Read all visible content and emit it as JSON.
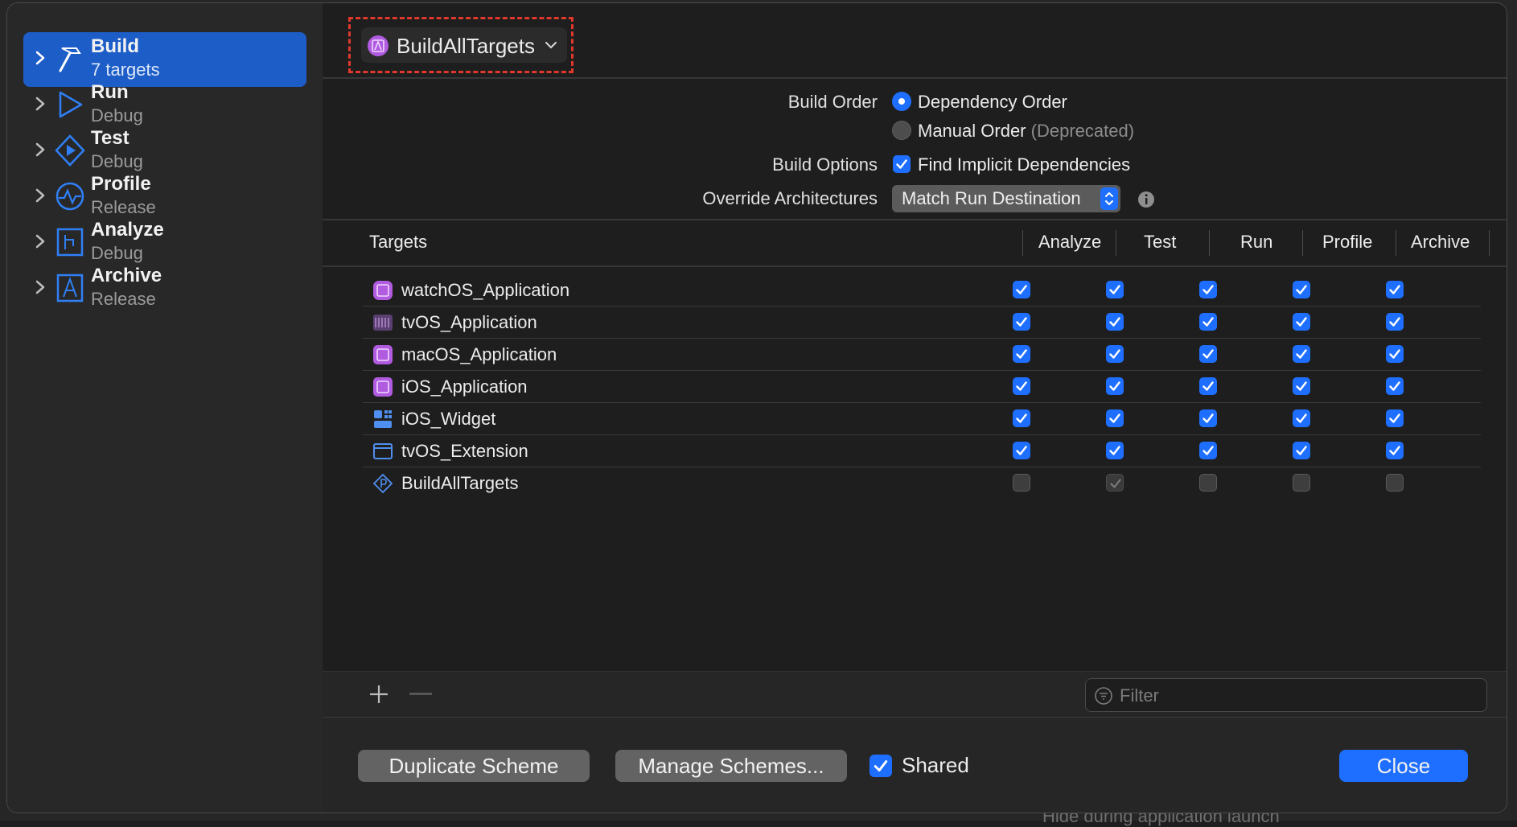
{
  "scheme": {
    "name": "BuildAllTargets"
  },
  "sidebar": {
    "items": [
      {
        "title": "Build",
        "subtitle": "7 targets",
        "selected": true,
        "icon": "hammer-icon"
      },
      {
        "title": "Run",
        "subtitle": "Debug",
        "selected": false,
        "icon": "play-icon"
      },
      {
        "title": "Test",
        "subtitle": "Debug",
        "selected": false,
        "icon": "test-diamond-icon"
      },
      {
        "title": "Profile",
        "subtitle": "Release",
        "selected": false,
        "icon": "gauge-icon"
      },
      {
        "title": "Analyze",
        "subtitle": "Debug",
        "selected": false,
        "icon": "analyze-icon"
      },
      {
        "title": "Archive",
        "subtitle": "Release",
        "selected": false,
        "icon": "archive-icon"
      }
    ]
  },
  "options": {
    "build_order_label": "Build Order",
    "dependency_order": "Dependency Order",
    "manual_order": "Manual Order",
    "manual_order_note": "(Deprecated)",
    "build_options_label": "Build Options",
    "find_implicit": "Find Implicit Dependencies",
    "override_arch_label": "Override Architectures",
    "override_arch_value": "Match Run Destination"
  },
  "table": {
    "headers": {
      "targets": "Targets",
      "analyze": "Analyze",
      "test": "Test",
      "run": "Run",
      "profile": "Profile",
      "archive": "Archive"
    },
    "rows": [
      {
        "name": "watchOS_Application",
        "icon": "app-icon",
        "checks": [
          true,
          true,
          true,
          true,
          true
        ]
      },
      {
        "name": "tvOS_Application",
        "icon": "tv-app-icon",
        "checks": [
          true,
          true,
          true,
          true,
          true
        ]
      },
      {
        "name": "macOS_Application",
        "icon": "app-icon",
        "checks": [
          true,
          true,
          true,
          true,
          true
        ]
      },
      {
        "name": "iOS_Application",
        "icon": "app-icon",
        "checks": [
          true,
          true,
          true,
          true,
          true
        ]
      },
      {
        "name": "iOS_Widget",
        "icon": "widget-icon",
        "checks": [
          true,
          true,
          true,
          true,
          true
        ]
      },
      {
        "name": "tvOS_Extension",
        "icon": "extension-icon",
        "checks": [
          true,
          true,
          true,
          true,
          true
        ]
      },
      {
        "name": "BuildAllTargets",
        "icon": "aggregate-target-icon",
        "checks": [
          false,
          "disabled-checked",
          false,
          false,
          false
        ]
      }
    ]
  },
  "filter": {
    "placeholder": "Filter"
  },
  "footer": {
    "duplicate": "Duplicate Scheme",
    "manage": "Manage Schemes...",
    "shared": "Shared",
    "close": "Close"
  },
  "background": {
    "hint_text": "Hide during application launch"
  },
  "colors": {
    "accent": "#1e6fff",
    "selection": "#1d5dc7",
    "highlight": "#e0382c"
  }
}
